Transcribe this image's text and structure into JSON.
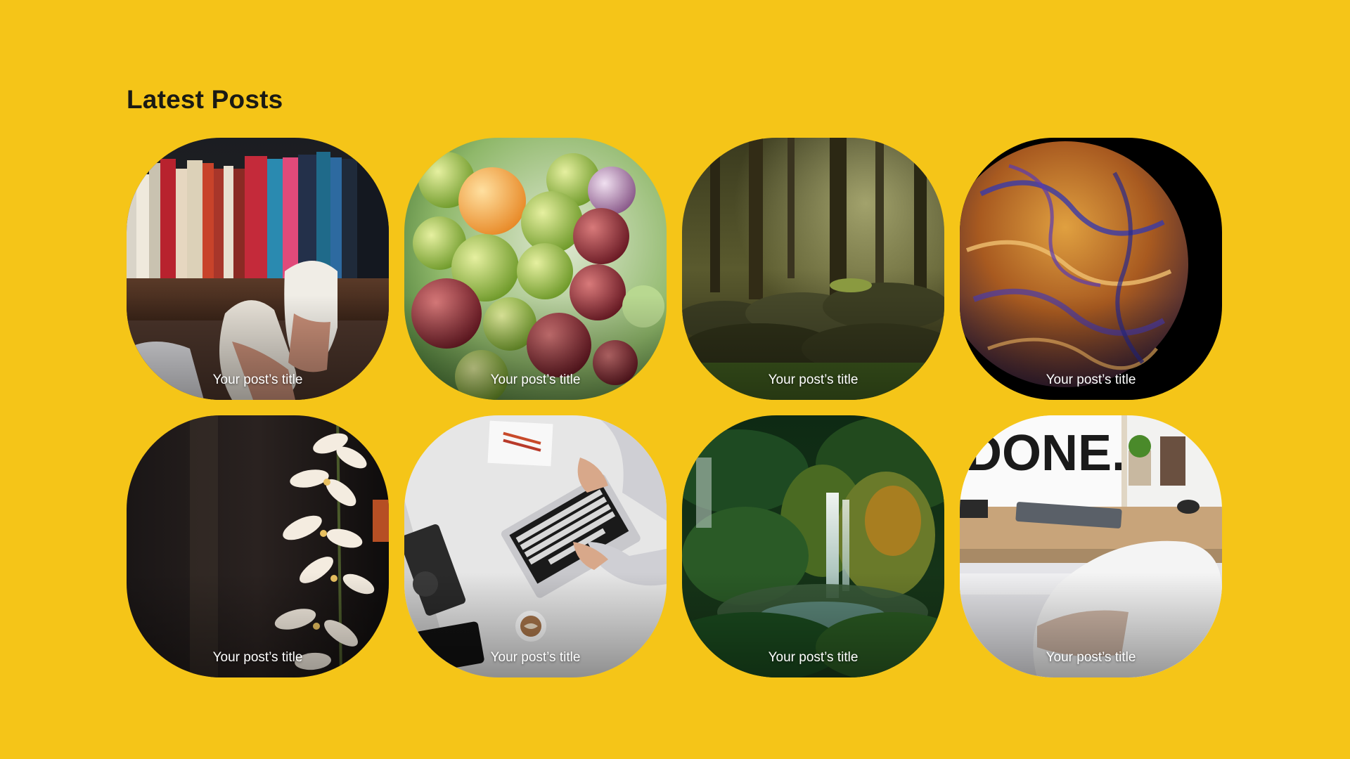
{
  "section": {
    "title": "Latest Posts"
  },
  "colors": {
    "background": "#F5C518",
    "title": "#1A1A14",
    "card_text": "#FFFFFF"
  },
  "posts": [
    {
      "title": "Your post’s title",
      "image": "bookshelf-sneakers-image"
    },
    {
      "title": "Your post’s title",
      "image": "grapes-image"
    },
    {
      "title": "Your post’s title",
      "image": "forest-image"
    },
    {
      "title": "Your post’s title",
      "image": "marbled-planet-image"
    },
    {
      "title": "Your post’s title",
      "image": "white-flowers-image"
    },
    {
      "title": "Your post’s title",
      "image": "laptop-desk-image"
    },
    {
      "title": "Your post’s title",
      "image": "waterfall-image"
    },
    {
      "title": "Your post’s title",
      "image": "workspace-done-image"
    }
  ]
}
